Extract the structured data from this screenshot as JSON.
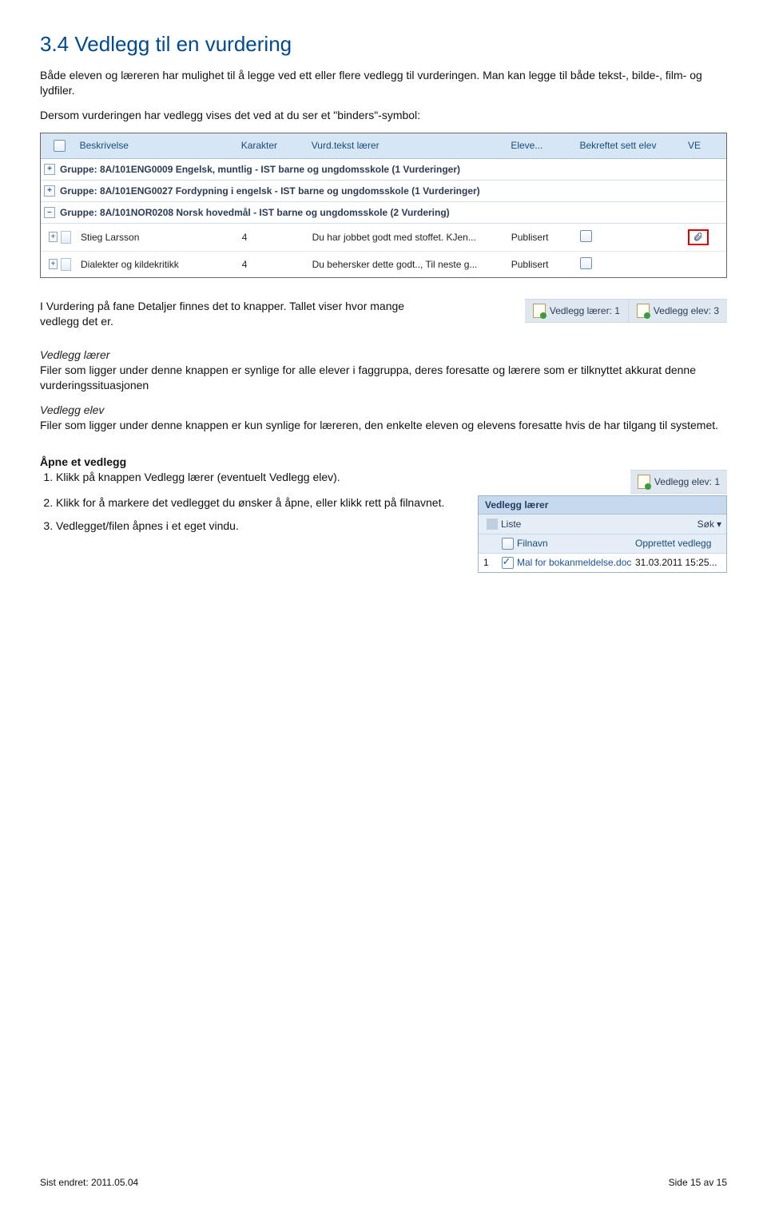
{
  "heading": "3.4 Vedlegg til en vurdering",
  "intro_p1": "Både eleven og læreren har mulighet til å legge ved ett eller flere vedlegg til vurderingen. Man kan legge til både tekst-, bilde-, film- og lydfiler.",
  "intro_p2": "Dersom vurderingen har vedlegg vises det ved at du ser et \"binders\"-symbol:",
  "table": {
    "headers": {
      "beskrivelse": "Beskrivelse",
      "karakter": "Karakter",
      "vurdTekst": "Vurd.tekst lærer",
      "elev": "Eleve...",
      "bekreftet": "Bekreftet sett elev",
      "ve": "VE"
    },
    "groups": [
      "Gruppe: 8A/101ENG0009 Engelsk, muntlig - IST barne og ungdomsskole (1 Vurderinger)",
      "Gruppe: 8A/101ENG0027 Fordypning i engelsk - IST barne og ungdomsskole (1 Vurderinger)",
      "Gruppe: 8A/101NOR0208 Norsk hovedmål - IST barne og ungdomsskole (2 Vurdering)"
    ],
    "rows": [
      {
        "desc": "Stieg Larsson",
        "kar": "4",
        "vt": "Du har jobbet godt med stoffet. KJen...",
        "el": "Publisert",
        "attach": true,
        "red": true
      },
      {
        "desc": "Dialekter og kildekritikk",
        "kar": "4",
        "vt": "Du behersker dette godt.., Til neste g...",
        "el": "Publisert",
        "attach": false,
        "red": false
      }
    ]
  },
  "after_table_p1": "I Vurdering på fane Detaljer finnes det to knapper. Tallet viser hvor mange vedlegg det er.",
  "pills": {
    "laerer": "Vedlegg lærer: 1",
    "elev": "Vedlegg elev: 3"
  },
  "vl_head": "Vedlegg lærer",
  "vl_body": "Filer som ligger under denne knappen er synlige for alle elever i faggruppa, deres foresatte og lærere som er tilknyttet akkurat denne vurderingssituasjonen",
  "ve_head": "Vedlegg elev",
  "ve_body": "Filer som ligger under denne knappen er kun synlige for læreren, den enkelte eleven og elevens foresatte hvis de har tilgang til systemet.",
  "open_head": "Åpne et vedlegg",
  "steps": [
    "Klikk på knappen Vedlegg lærer (eventuelt Vedlegg elev).",
    "Klikk for å markere det vedlegget du ønsker å åpne, eller klikk rett på filnavnet.",
    " Vedlegget/filen åpnes i et eget vindu."
  ],
  "pill_small": "Vedlegg elev: 1",
  "panel": {
    "title": "Vedlegg lærer",
    "liste": "Liste",
    "sok": "Søk",
    "h_fil": "Filnavn",
    "h_dt": "Opprettet vedlegg",
    "row": {
      "num": "1",
      "fn": "Mal for bokanmeldelse.doc",
      "dt": "31.03.2011 15:25..."
    }
  },
  "footer": {
    "left": "Sist endret: 2011.05.04",
    "right": "Side 15 av 15"
  }
}
